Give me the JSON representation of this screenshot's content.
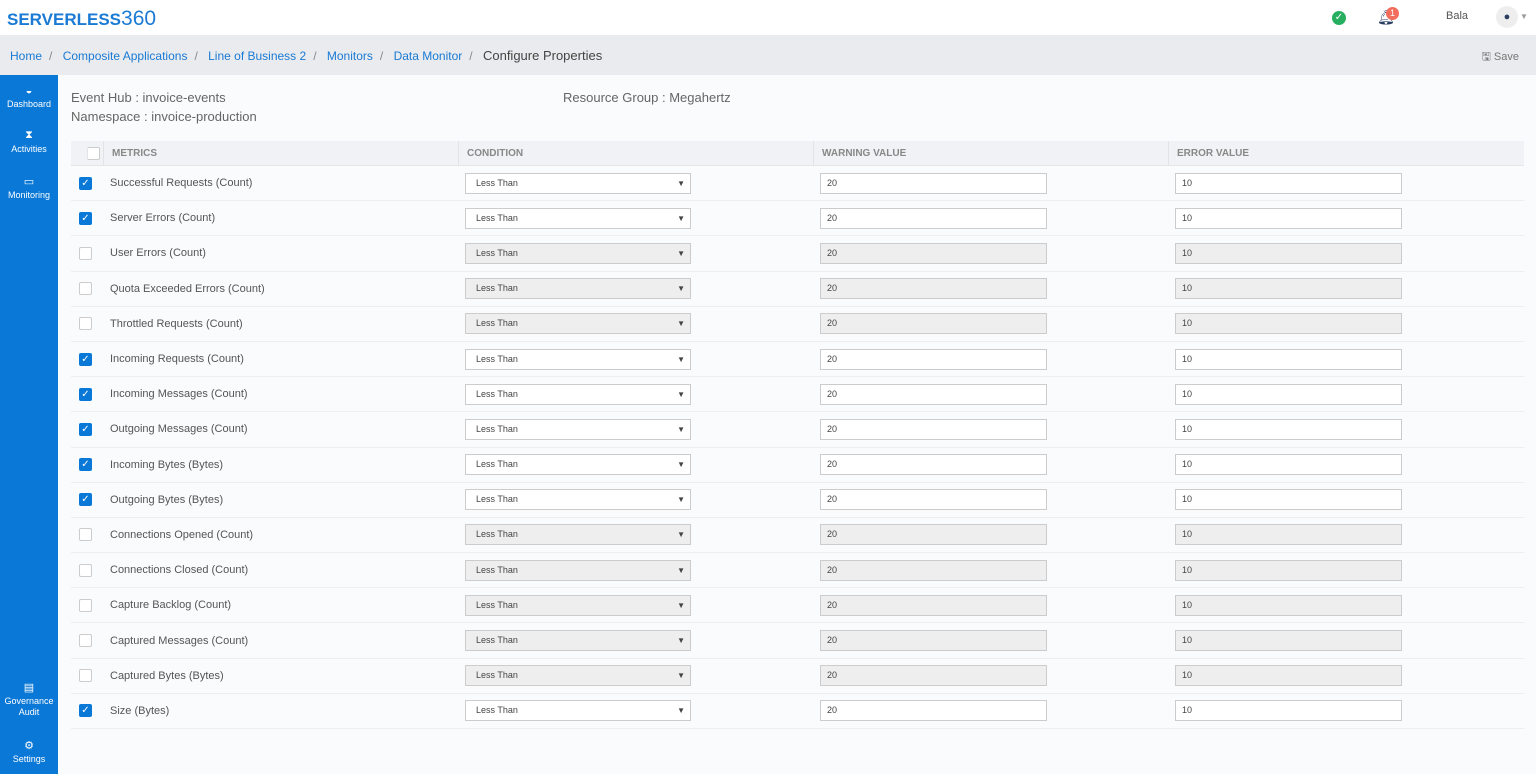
{
  "brand": {
    "name": "SERVERLESS",
    "num": "360"
  },
  "header": {
    "user": "Bala",
    "notifications": "1"
  },
  "breadcrumb": [
    "Home",
    "Composite Applications",
    "Line of Business 2",
    "Monitors",
    "Data Monitor"
  ],
  "page_title": "Configure Properties",
  "save_label": "Save",
  "sidebar": {
    "dashboard": "Dashboard",
    "activities": "Activities",
    "monitoring": "Monitoring",
    "governance": "Governance Audit",
    "settings": "Settings"
  },
  "info": {
    "event_hub": "Event Hub : invoice-events",
    "namespace": "Namespace : invoice-production",
    "resource_group": "Resource Group : Megahertz"
  },
  "columns": [
    "METRICS",
    "CONDITION",
    "WARNING VALUE",
    "ERROR VALUE"
  ],
  "rows": [
    {
      "metric": "Successful Requests (Count)",
      "checked": true,
      "condition": "Less Than",
      "warning": "20",
      "error": "10"
    },
    {
      "metric": "Server Errors (Count)",
      "checked": true,
      "condition": "Less Than",
      "warning": "20",
      "error": "10"
    },
    {
      "metric": "User Errors (Count)",
      "checked": false,
      "condition": "Less Than",
      "warning": "20",
      "error": "10"
    },
    {
      "metric": "Quota Exceeded Errors (Count)",
      "checked": false,
      "condition": "Less Than",
      "warning": "20",
      "error": "10"
    },
    {
      "metric": "Throttled Requests (Count)",
      "checked": false,
      "condition": "Less Than",
      "warning": "20",
      "error": "10"
    },
    {
      "metric": "Incoming Requests (Count)",
      "checked": true,
      "condition": "Less Than",
      "warning": "20",
      "error": "10"
    },
    {
      "metric": "Incoming Messages (Count)",
      "checked": true,
      "condition": "Less Than",
      "warning": "20",
      "error": "10"
    },
    {
      "metric": "Outgoing Messages (Count)",
      "checked": true,
      "condition": "Less Than",
      "warning": "20",
      "error": "10"
    },
    {
      "metric": "Incoming Bytes (Bytes)",
      "checked": true,
      "condition": "Less Than",
      "warning": "20",
      "error": "10"
    },
    {
      "metric": "Outgoing Bytes (Bytes)",
      "checked": true,
      "condition": "Less Than",
      "warning": "20",
      "error": "10"
    },
    {
      "metric": "Connections Opened (Count)",
      "checked": false,
      "condition": "Less Than",
      "warning": "20",
      "error": "10"
    },
    {
      "metric": "Connections Closed (Count)",
      "checked": false,
      "condition": "Less Than",
      "warning": "20",
      "error": "10"
    },
    {
      "metric": "Capture Backlog (Count)",
      "checked": false,
      "condition": "Less Than",
      "warning": "20",
      "error": "10"
    },
    {
      "metric": "Captured Messages (Count)",
      "checked": false,
      "condition": "Less Than",
      "warning": "20",
      "error": "10"
    },
    {
      "metric": "Captured Bytes (Bytes)",
      "checked": false,
      "condition": "Less Than",
      "warning": "20",
      "error": "10"
    },
    {
      "metric": "Size (Bytes)",
      "checked": true,
      "condition": "Less Than",
      "warning": "20",
      "error": "10"
    }
  ]
}
